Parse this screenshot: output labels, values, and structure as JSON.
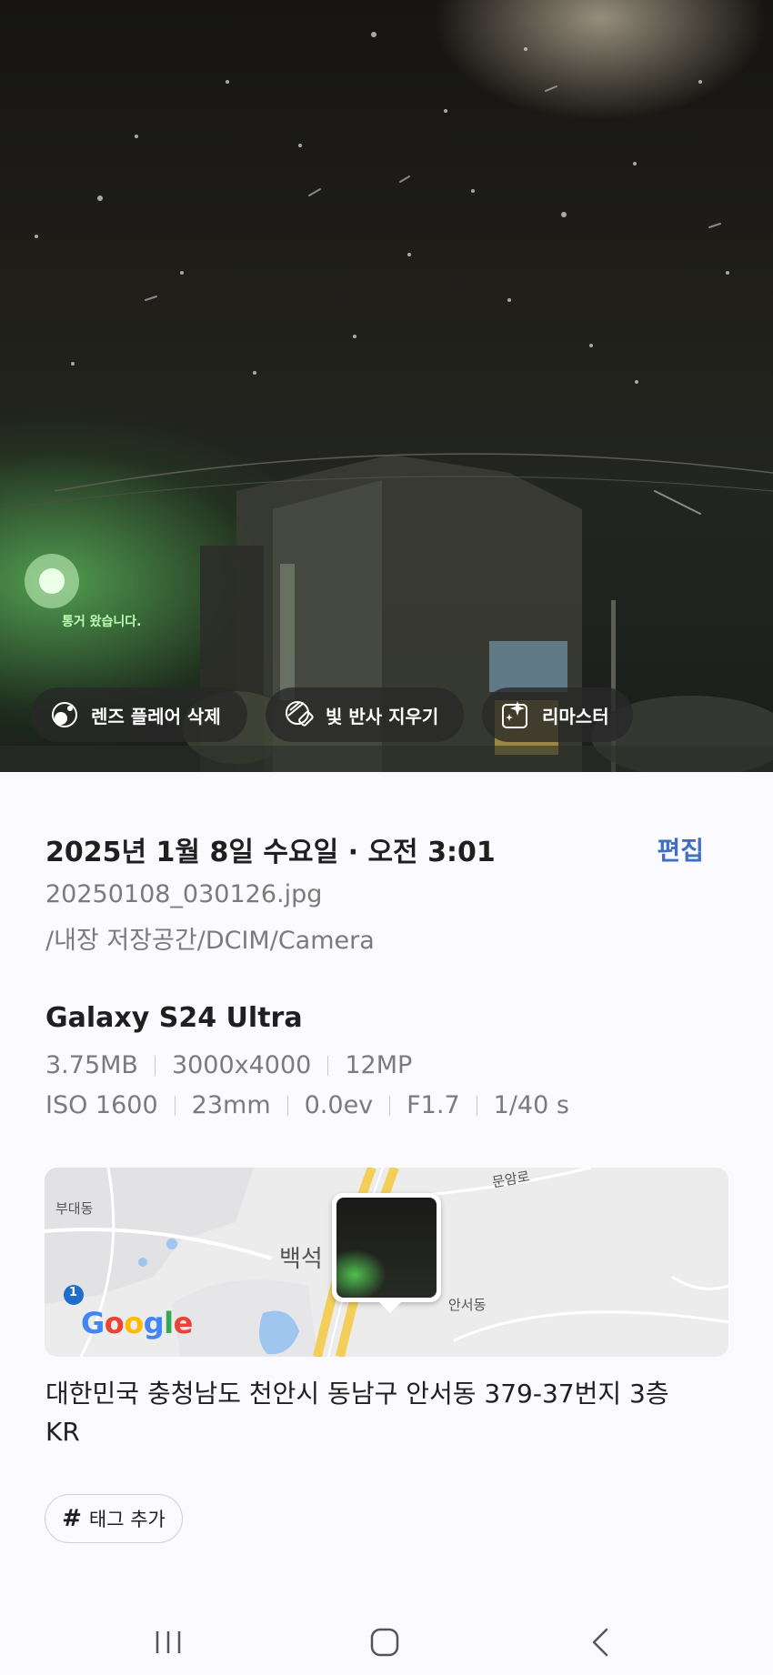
{
  "photo": {
    "sign_text": "통거 왔습니다.",
    "chips": [
      {
        "label": "렌즈 플레어 삭제",
        "icon": "lens-flare-icon"
      },
      {
        "label": "빛 반사 지우기",
        "icon": "reflection-eraser-icon"
      },
      {
        "label": "리마스터",
        "icon": "remaster-sparkle-icon"
      }
    ]
  },
  "details": {
    "datetime": "2025년 1월 8일 수요일 · 오전 3:01",
    "edit_label": "편집",
    "filename": "20250108_030126.jpg",
    "path": "/내장 저장공간/DCIM/Camera",
    "device": "Galaxy S24 Ultra",
    "specs_row1": [
      "3.75MB",
      "3000x4000",
      "12MP"
    ],
    "specs_row2": [
      "ISO 1600",
      "23mm",
      "0.0ev",
      "F1.7",
      "1/40 s"
    ]
  },
  "map": {
    "labels": [
      "부대동",
      "문암로",
      "백석",
      "안서동",
      "1"
    ],
    "logo": "Google"
  },
  "location": {
    "address": "대한민국 충청남도 천안시 동남구 안서동 379-37번지 3층",
    "country": "KR"
  },
  "tag_button": {
    "label": "태그 추가",
    "icon": "hash-icon"
  },
  "navbar": {
    "icons": [
      "recent-apps-icon",
      "home-icon",
      "back-icon"
    ]
  }
}
